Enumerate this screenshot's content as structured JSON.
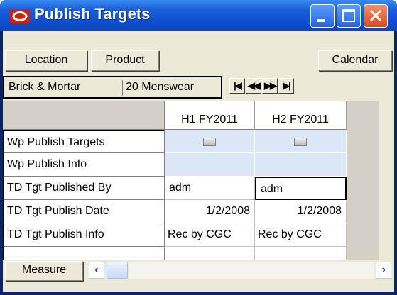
{
  "window": {
    "title": "Publish Targets",
    "colors": {
      "titlebar": "#1a5fd8",
      "accent": "#d81e05",
      "cell_blue": "#dbe7f7"
    }
  },
  "toolbar": {
    "location_label": "Location",
    "product_label": "Product",
    "calendar_label": "Calendar"
  },
  "header": {
    "location": "Brick & Mortar",
    "product": "20 Menswear"
  },
  "nav_icons": [
    "first-page-icon",
    "previous-page-icon",
    "next-page-icon",
    "last-page-icon"
  ],
  "grid": {
    "columns": [
      "H1 FY2011",
      "H2 FY2011"
    ],
    "rows": [
      {
        "label": "Wp Publish Targets",
        "values": [
          "",
          ""
        ]
      },
      {
        "label": "Wp Publish Info",
        "values": [
          "",
          ""
        ]
      },
      {
        "label": "TD Tgt Published By",
        "values": [
          "adm",
          "adm"
        ]
      },
      {
        "label": "TD Tgt Publish Date",
        "values": [
          "1/2/2008",
          "1/2/2008"
        ]
      },
      {
        "label": "TD Tgt Publish Info",
        "values": [
          "Rec by CGC",
          "Rec by CGC"
        ]
      }
    ]
  },
  "bottom": {
    "measure_label": "Measure"
  }
}
